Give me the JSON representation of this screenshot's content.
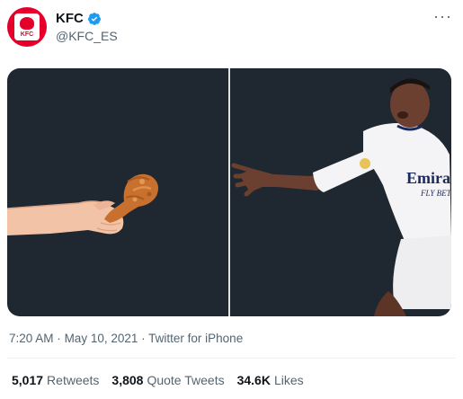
{
  "account": {
    "name": "KFC",
    "handle": "@KFC_ES",
    "avatar_text": "KFC",
    "verified_icon": "verified-badge-icon",
    "brand_color": "#e4002b",
    "verified_color": "#1d9bf0"
  },
  "more_icon": "more-options-icon",
  "media": {
    "left_panel": "hand-holding-chicken",
    "right_panel": "player-reaching",
    "jersey_text": [
      "Emirat",
      "FLY BETT"
    ],
    "background_color": "#1f2730"
  },
  "meta": {
    "time": "7:20 AM",
    "date": "May 10, 2021",
    "source": "Twitter for iPhone",
    "separator": "·"
  },
  "stats": [
    {
      "count": "5,017",
      "label": "Retweets"
    },
    {
      "count": "3,808",
      "label": "Quote Tweets"
    },
    {
      "count": "34.6K",
      "label": "Likes"
    }
  ]
}
